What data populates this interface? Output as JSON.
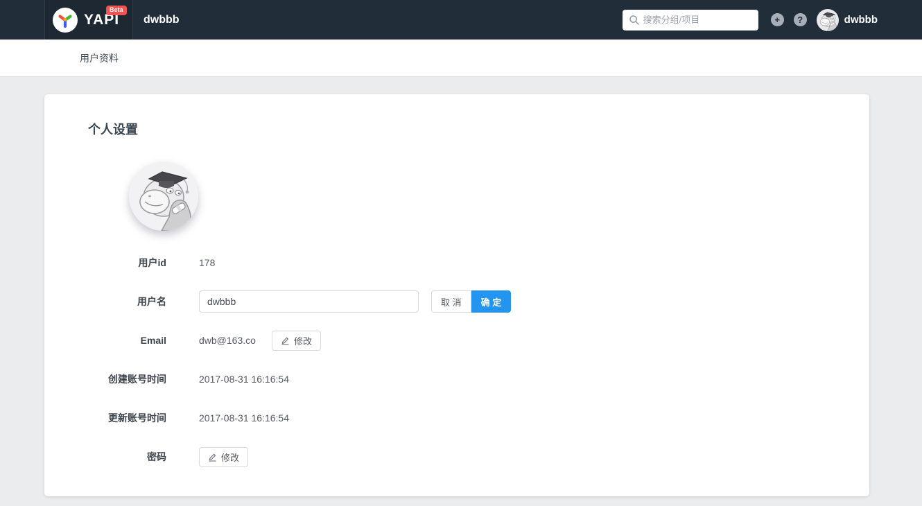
{
  "navbar": {
    "logo_text": "YAPI",
    "beta_badge": "Beta",
    "page_title": "dwbbb",
    "search_placeholder": "搜索分组/项目",
    "username": "dwbbb",
    "add_icon_glyph": "+",
    "help_icon_glyph": "?"
  },
  "subnav": {
    "title": "用户资料"
  },
  "profile": {
    "heading": "个人设置",
    "fields": {
      "user_id": {
        "label": "用户id",
        "value": "178"
      },
      "username": {
        "label": "用户名",
        "input_value": "dwbbb",
        "cancel_label": "取 消",
        "confirm_label": "确 定"
      },
      "email": {
        "label": "Email",
        "value": "dwb@163.co",
        "edit_label": "修改"
      },
      "created": {
        "label": "创建账号时间",
        "value": "2017-08-31 16:16:54"
      },
      "updated": {
        "label": "更新账号时间",
        "value": "2017-08-31 16:16:54"
      },
      "password": {
        "label": "密码",
        "edit_label": "修改"
      }
    }
  },
  "colors": {
    "navbar_bg": "#222d3a",
    "accent_blue": "#2395f1",
    "beta_red": "#f15352",
    "page_bg": "#ebeced",
    "logo_red": "#f4503e",
    "logo_green": "#43ba33",
    "logo_blue": "#3b5ef2"
  }
}
